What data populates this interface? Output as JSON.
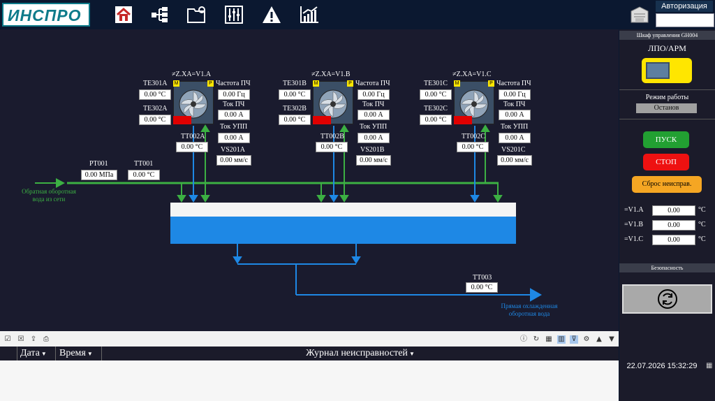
{
  "header": {
    "logo_text": "ИНСПРО",
    "nav_icons": [
      "home-icon",
      "network-tree-icon",
      "folder-settings-icon",
      "sliders-icon",
      "warning-icon",
      "trend-chart-icon"
    ],
    "auth_label": "Авторизация",
    "auth_value": ""
  },
  "schema": {
    "units": [
      {
        "id": "A",
        "hdr": "≠Z.XA=V1.A",
        "te301": "TE301A",
        "te301_val": "0.00 °C",
        "te302": "TE302A",
        "te302_val": "0.00 °C",
        "tt002": "TT002A",
        "tt002_val": "0.00 °C",
        "freq_lbl": "Частота ПЧ",
        "freq_val": "0.00 Гц",
        "cur_lbl": "Ток ПЧ",
        "cur_val": "0.00 А",
        "upp_lbl": "Ток УПП",
        "upp_val": "0.00 А",
        "vs_lbl": "VS201A",
        "vs_val": "0.00 мм/с"
      },
      {
        "id": "B",
        "hdr": "≠Z.XA=V1.B",
        "te301": "TE301B",
        "te301_val": "0.00 °C",
        "te302": "TE302B",
        "te302_val": "0.00 °C",
        "tt002": "TT002B",
        "tt002_val": "0.00 °C",
        "freq_lbl": "Частота ПЧ",
        "freq_val": "0.00 Гц",
        "cur_lbl": "Ток ПЧ",
        "cur_val": "0.00 А",
        "upp_lbl": "Ток УПП",
        "upp_val": "0.00 А",
        "vs_lbl": "VS201B",
        "vs_val": "0.00 мм/с"
      },
      {
        "id": "C",
        "hdr": "≠Z.XA=V1.C",
        "te301": "TE301C",
        "te301_val": "0.00 °C",
        "te302": "TE302C",
        "te302_val": "0.00 °C",
        "tt002": "TT002C",
        "tt002_val": "0.00 °C",
        "freq_lbl": "Частота ПЧ",
        "freq_val": "0.00 Гц",
        "cur_lbl": "Ток ПЧ",
        "cur_val": "0.00 А",
        "upp_lbl": "Ток УПП",
        "upp_val": "0.00 А",
        "vs_lbl": "VS201C",
        "vs_val": "0.00 мм/с"
      }
    ],
    "tag_m": "M",
    "tag_p": "P",
    "pt001": "PT001",
    "pt001_val": "0.00 МПа",
    "tt001": "TT001",
    "tt001_val": "0.00 °C",
    "inlet_line1": "Обратная оборотная",
    "inlet_line2": "вода из сети",
    "tt003": "TT003",
    "tt003_val": "0.00 °C",
    "outlet_line1": "Прямая охлажденная",
    "outlet_line2": "оборотная вода"
  },
  "panel": {
    "cabinet_title": "Шкаф управления GH004",
    "mode_switch_label": "ЛПО/АРМ",
    "work_mode_label": "Режим работы",
    "work_mode_value": "Останов",
    "start_label": "ПУСК",
    "stop_label": "СТОП",
    "reset_label": "Сброс неисправ.",
    "temps": [
      {
        "label": "=V1.A",
        "value": "0.00",
        "unit": "°C"
      },
      {
        "label": "=V1.B",
        "value": "0.00",
        "unit": "°C"
      },
      {
        "label": "=V1.C",
        "value": "0.00",
        "unit": "°C"
      }
    ],
    "safety_title": "Безопасность"
  },
  "journal": {
    "col_date": "Дата",
    "col_time": "Время",
    "col_title": "Журнал неисправностей"
  },
  "clock": "22.07.2026 15:32:29",
  "colors": {
    "accent": "#0e7b8a",
    "water": "#1e88e5",
    "return": "#3cb043",
    "start": "#22a032",
    "stop": "#ee1111",
    "reset": "#f5a623"
  }
}
